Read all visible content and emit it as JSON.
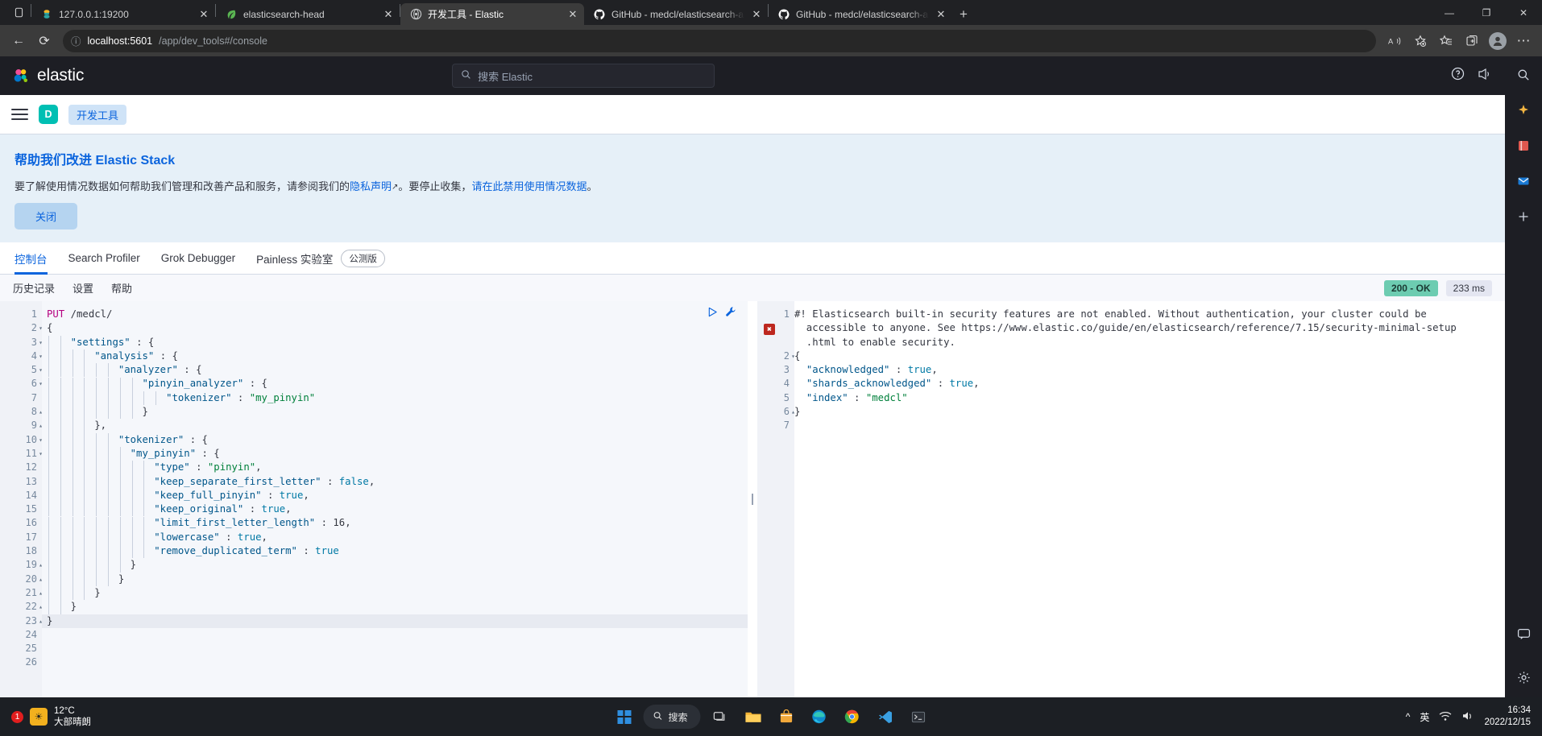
{
  "browser": {
    "tabs": [
      {
        "title": "127.0.0.1:19200",
        "favicon": "elasticsearch-head-icon",
        "active": false
      },
      {
        "title": "elasticsearch-head",
        "favicon": "leaf-icon",
        "active": false
      },
      {
        "title": "开发工具 - Elastic",
        "favicon": "kibana-icon",
        "active": true
      },
      {
        "title": "GitHub - medcl/elasticsearch-ana",
        "favicon": "github-icon",
        "active": false
      },
      {
        "title": "GitHub - medcl/elasticsearch-ana",
        "favicon": "github-icon",
        "active": false
      }
    ],
    "new_tab_label": "+",
    "window_controls": {
      "minimize": "—",
      "maximize": "❐",
      "close": "✕"
    },
    "nav": {
      "back": "←",
      "reload": "⟳",
      "site_info": "ⓘ",
      "url_host": "localhost:5601",
      "url_path": "/app/dev_tools#/console",
      "read_aloud": "A",
      "add_favorite": "☆",
      "favorites": "☆",
      "collections": "⧉",
      "profile": "avatar",
      "settings_more": "⋯"
    }
  },
  "kibana": {
    "brand": "elastic",
    "search_placeholder": "搜索 Elastic",
    "header_icons": [
      "help-icon",
      "news-icon"
    ],
    "breadcrumbs": {
      "space_initial": "D",
      "current": "开发工具"
    },
    "callout": {
      "title": "帮助我们改进 Elastic Stack",
      "body_before_link1": "要了解使用情况数据如何帮助我们管理和改善产品和服务，请参阅我们的",
      "link1": "隐私声明",
      "body_between": "。要停止收集，",
      "link2": "请在此禁用使用情况数据",
      "body_after": "。",
      "close_label": "关闭"
    },
    "tabs": [
      {
        "label": "控制台",
        "selected": true
      },
      {
        "label": "Search Profiler",
        "selected": false
      },
      {
        "label": "Grok Debugger",
        "selected": false
      },
      {
        "label": "Painless 实验室",
        "selected": false
      }
    ],
    "beta_pill": "公测版",
    "devtools_toolbar": [
      "历史记录",
      "设置",
      "帮助"
    ],
    "status": {
      "code": "200 - OK",
      "time": "233 ms"
    },
    "editor_actions": {
      "send": "play-icon",
      "wrench": "wrench-icon"
    },
    "request_editor": {
      "total_lines": 26,
      "highlighted_line": 23,
      "lines": [
        {
          "n": 1,
          "fold": "",
          "html": "<span class='k-method'>PUT</span> <span class='k-url'>/medcl/</span>"
        },
        {
          "n": 2,
          "fold": "▾",
          "html": "<span class='k-punc'>{</span>"
        },
        {
          "n": 3,
          "fold": "▾",
          "html": "    <span class='k-key'>\"settings\"</span> <span class='k-punc'>: {</span>"
        },
        {
          "n": 4,
          "fold": "▾",
          "html": "        <span class='k-key'>\"analysis\"</span> <span class='k-punc'>: {</span>"
        },
        {
          "n": 5,
          "fold": "▾",
          "html": "            <span class='k-key'>\"analyzer\"</span> <span class='k-punc'>: {</span>"
        },
        {
          "n": 6,
          "fold": "▾",
          "html": "                <span class='k-key'>\"pinyin_analyzer\"</span> <span class='k-punc'>: {</span>"
        },
        {
          "n": 7,
          "fold": "",
          "html": "                    <span class='k-key'>\"tokenizer\"</span> <span class='k-punc'>:</span> <span class='k-str'>\"my_pinyin\"</span>"
        },
        {
          "n": 8,
          "fold": "▴",
          "html": "                <span class='k-punc'>}</span>"
        },
        {
          "n": 9,
          "fold": "▴",
          "html": "        <span class='k-punc'>},</span>"
        },
        {
          "n": 10,
          "fold": "▾",
          "html": "            <span class='k-key'>\"tokenizer\"</span> <span class='k-punc'>: {</span>"
        },
        {
          "n": 11,
          "fold": "▾",
          "html": "              <span class='k-key'>\"my_pinyin\"</span> <span class='k-punc'>: {</span>"
        },
        {
          "n": 12,
          "fold": "",
          "html": "                  <span class='k-key'>\"type\"</span> <span class='k-punc'>:</span> <span class='k-str'>\"pinyin\"</span><span class='k-punc'>,</span>"
        },
        {
          "n": 13,
          "fold": "",
          "html": "                  <span class='k-key'>\"keep_separate_first_letter\"</span> <span class='k-punc'>:</span> <span class='k-val'>false</span><span class='k-punc'>,</span>"
        },
        {
          "n": 14,
          "fold": "",
          "html": "                  <span class='k-key'>\"keep_full_pinyin\"</span> <span class='k-punc'>:</span> <span class='k-val'>true</span><span class='k-punc'>,</span>"
        },
        {
          "n": 15,
          "fold": "",
          "html": "                  <span class='k-key'>\"keep_original\"</span> <span class='k-punc'>:</span> <span class='k-val'>true</span><span class='k-punc'>,</span>"
        },
        {
          "n": 16,
          "fold": "",
          "html": "                  <span class='k-key'>\"limit_first_letter_length\"</span> <span class='k-punc'>:</span> <span class='k-num'>16</span><span class='k-punc'>,</span>"
        },
        {
          "n": 17,
          "fold": "",
          "html": "                  <span class='k-key'>\"lowercase\"</span> <span class='k-punc'>:</span> <span class='k-val'>true</span><span class='k-punc'>,</span>"
        },
        {
          "n": 18,
          "fold": "",
          "html": "                  <span class='k-key'>\"remove_duplicated_term\"</span> <span class='k-punc'>:</span> <span class='k-val'>true</span>"
        },
        {
          "n": 19,
          "fold": "▴",
          "html": "              <span class='k-punc'>}</span>"
        },
        {
          "n": 20,
          "fold": "▴",
          "html": "            <span class='k-punc'>}</span>"
        },
        {
          "n": 21,
          "fold": "▴",
          "html": "        <span class='k-punc'>}</span>"
        },
        {
          "n": 22,
          "fold": "▴",
          "html": "    <span class='k-punc'>}</span>"
        },
        {
          "n": 23,
          "fold": "▴",
          "html": "<span class='k-punc'>}</span>"
        },
        {
          "n": 24,
          "fold": "",
          "html": ""
        },
        {
          "n": 25,
          "fold": "",
          "html": ""
        },
        {
          "n": 26,
          "fold": "",
          "html": ""
        }
      ],
      "raw_text": "PUT /medcl/\n{\n    \"settings\" : {\n        \"analysis\" : {\n            \"analyzer\" : {\n                \"pinyin_analyzer\" : {\n                    \"tokenizer\" : \"my_pinyin\"\n                }\n        },\n            \"tokenizer\" : {\n              \"my_pinyin\" : {\n                  \"type\" : \"pinyin\",\n                  \"keep_separate_first_letter\" : false,\n                  \"keep_full_pinyin\" : true,\n                  \"keep_original\" : true,\n                  \"limit_first_letter_length\" : 16,\n                  \"lowercase\" : true,\n                  \"remove_duplicated_term\" : true\n              }\n            }\n        }\n    }\n}"
    },
    "response_editor": {
      "error_marker": "✖",
      "lines": [
        {
          "n": "1",
          "fold": "",
          "html": "<span class='k-warn'>#! Elasticsearch built-in security features are not enabled. Without authentication, your cluster could be</span>"
        },
        {
          "n": "",
          "fold": "",
          "html": "<span class='k-warn'>  accessible to anyone. See https://www.elastic.co/guide/en/elasticsearch/reference/7.15/security-minimal-setup</span>"
        },
        {
          "n": "",
          "fold": "",
          "html": "<span class='k-warn'>  .html to enable security.</span>"
        },
        {
          "n": "2",
          "fold": "▾",
          "html": "<span class='k-punc'>{</span>"
        },
        {
          "n": "3",
          "fold": "",
          "html": "  <span class='k-key'>\"acknowledged\"</span> <span class='k-punc'>:</span> <span class='k-val'>true</span><span class='k-punc'>,</span>"
        },
        {
          "n": "4",
          "fold": "",
          "html": "  <span class='k-key'>\"shards_acknowledged\"</span> <span class='k-punc'>:</span> <span class='k-val'>true</span><span class='k-punc'>,</span>"
        },
        {
          "n": "5",
          "fold": "",
          "html": "  <span class='k-key'>\"index\"</span> <span class='k-punc'>:</span> <span class='k-str'>\"medcl\"</span>"
        },
        {
          "n": "6",
          "fold": "▴",
          "html": "<span class='k-punc'>}</span>"
        },
        {
          "n": "7",
          "fold": "",
          "html": ""
        }
      ],
      "raw_text": "#! Elasticsearch built-in security features are not enabled. Without authentication, your cluster could be accessible to anyone. See https://www.elastic.co/guide/en/elasticsearch/reference/7.15/security-minimal-setup.html to enable security.\n{\n  \"acknowledged\" : true,\n  \"shards_acknowledged\" : true,\n  \"index\" : \"medcl\"\n}"
    },
    "right_rail_icons": [
      "search-icon",
      "sparkle-icon",
      "book-icon",
      "mail-icon",
      "add-icon",
      "chat-icon",
      "gear-icon"
    ]
  },
  "taskbar": {
    "weather": {
      "temp": "12°C",
      "desc": "大部晴朗",
      "badge": "1"
    },
    "start": "windows-logo-icon",
    "search_label": "搜索",
    "apps": [
      "task-view-icon",
      "file-explorer-icon",
      "store-icon",
      "edge-icon",
      "chrome-icon",
      "vscode-icon",
      "terminal-icon"
    ],
    "tray": {
      "chevron": "^",
      "ime": "英",
      "network": "network-icon",
      "volume": "volume-icon"
    },
    "clock": {
      "time": "16:34",
      "date": "2022/12/15"
    }
  },
  "colors": {
    "accent": "#0b64dd",
    "brand_teal": "#00BFB3",
    "success": "#6DCCB1",
    "danger": "#bd271e",
    "header_dark": "#1d1e24",
    "callout_bg": "#e6f0f8"
  }
}
